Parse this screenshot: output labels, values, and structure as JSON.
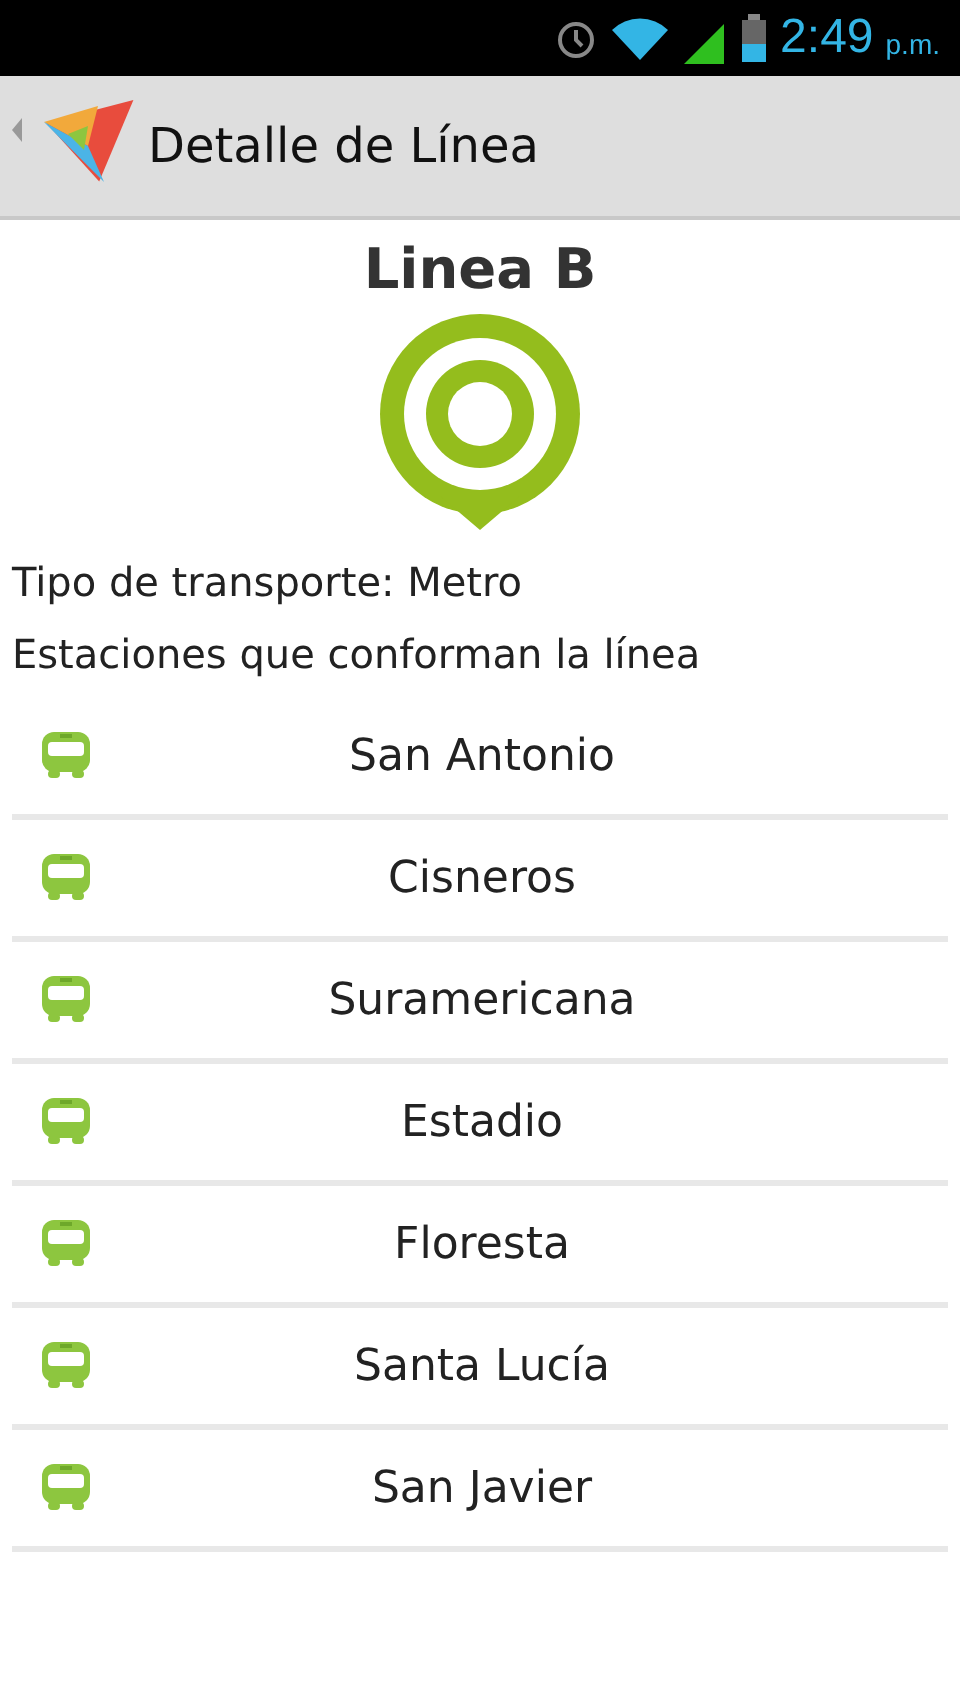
{
  "status_bar": {
    "time": "2:49",
    "period": "p.m."
  },
  "action_bar": {
    "title": "Detalle de Línea"
  },
  "line": {
    "name": "Linea B",
    "transport": "Tipo de transporte: Metro",
    "stations_heading": "Estaciones que conforman la línea"
  },
  "stations": [
    {
      "name": "San Antonio"
    },
    {
      "name": "Cisneros"
    },
    {
      "name": "Suramericana"
    },
    {
      "name": "Estadio"
    },
    {
      "name": "Floresta"
    },
    {
      "name": "Santa Lucía"
    },
    {
      "name": "San Javier"
    }
  ]
}
